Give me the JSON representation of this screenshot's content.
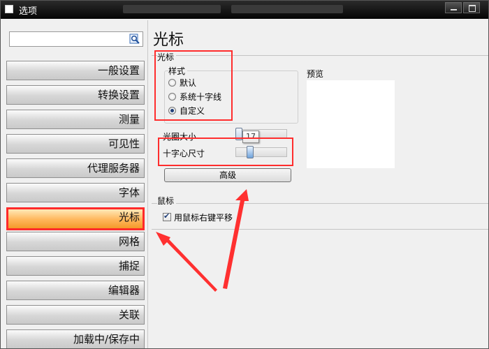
{
  "window": {
    "title": "选项"
  },
  "sidebar": {
    "search": {
      "value": "",
      "placeholder": ""
    },
    "items": [
      {
        "label": "一般设置"
      },
      {
        "label": "转换设置"
      },
      {
        "label": "测量"
      },
      {
        "label": "可见性"
      },
      {
        "label": "代理服务器"
      },
      {
        "label": "字体"
      },
      {
        "label": "光标",
        "selected": true
      },
      {
        "label": "网格"
      },
      {
        "label": "捕捉"
      },
      {
        "label": "编辑器"
      },
      {
        "label": "关联"
      },
      {
        "label": "加载中/保存中"
      }
    ]
  },
  "main": {
    "title": "光标",
    "cursor_group": {
      "label": "光标",
      "style_label": "样式",
      "options": [
        {
          "label": "默认",
          "checked": false
        },
        {
          "label": "系统十字线",
          "checked": false
        },
        {
          "label": "自定义",
          "checked": true
        }
      ],
      "aperture_label": "光圈大小",
      "aperture_tooltip": "17",
      "crosshair_label": "十字心尺寸",
      "advanced_button": "高级"
    },
    "preview_label": "预览",
    "mouse_group": {
      "label": "鼠标",
      "pan_label": "用鼠标右键平移",
      "pan_checked": true
    }
  },
  "colors": {
    "highlight": "#ff2d2d",
    "selected_item": "#ffb65a",
    "titlebar": "#111111"
  }
}
